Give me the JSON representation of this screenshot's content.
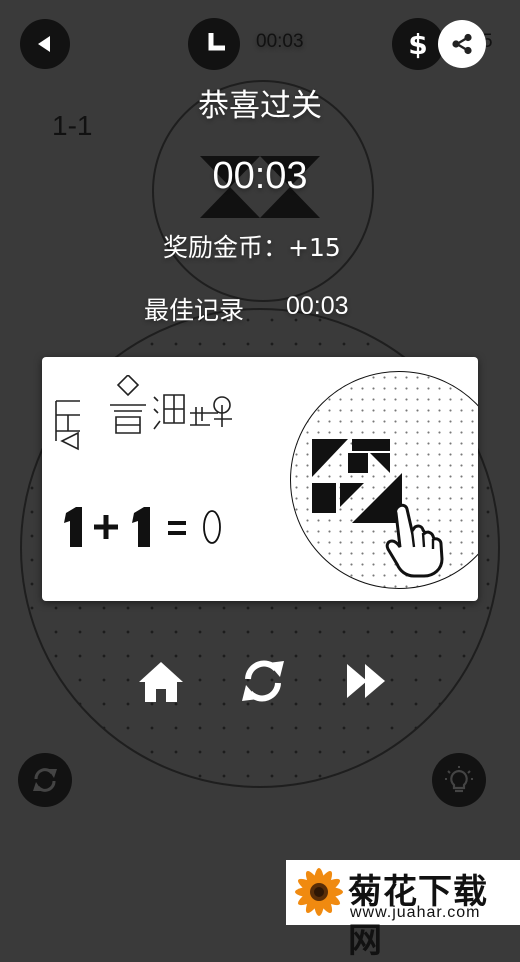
{
  "header": {
    "timer_value": "00:03",
    "coins_partial": "5",
    "level": "1-1"
  },
  "result": {
    "title": "恭喜过关",
    "time": "00:03",
    "reward_text": "奖励金币：+15",
    "best_label": "最佳记录",
    "best_time": "00:03"
  },
  "card": {
    "game_logo_text": "层叠消融",
    "equation": "1+1=0"
  },
  "watermark": {
    "brand": "菊花下载网",
    "url": "www.juahar.com"
  },
  "colors": {
    "background": "#3a3a3a",
    "button_dark": "#121212",
    "card": "#ffffff",
    "watermark_brand": "#111111",
    "flower_orange": "#f08a10"
  },
  "icons": {
    "back": "back-arrow-icon",
    "clock": "clock-icon",
    "coin": "dollar-icon",
    "share": "share-icon",
    "home": "home-icon",
    "replay": "replay-icon",
    "next": "fast-forward-icon",
    "restart": "restart-icon",
    "hint": "lightbulb-icon"
  }
}
